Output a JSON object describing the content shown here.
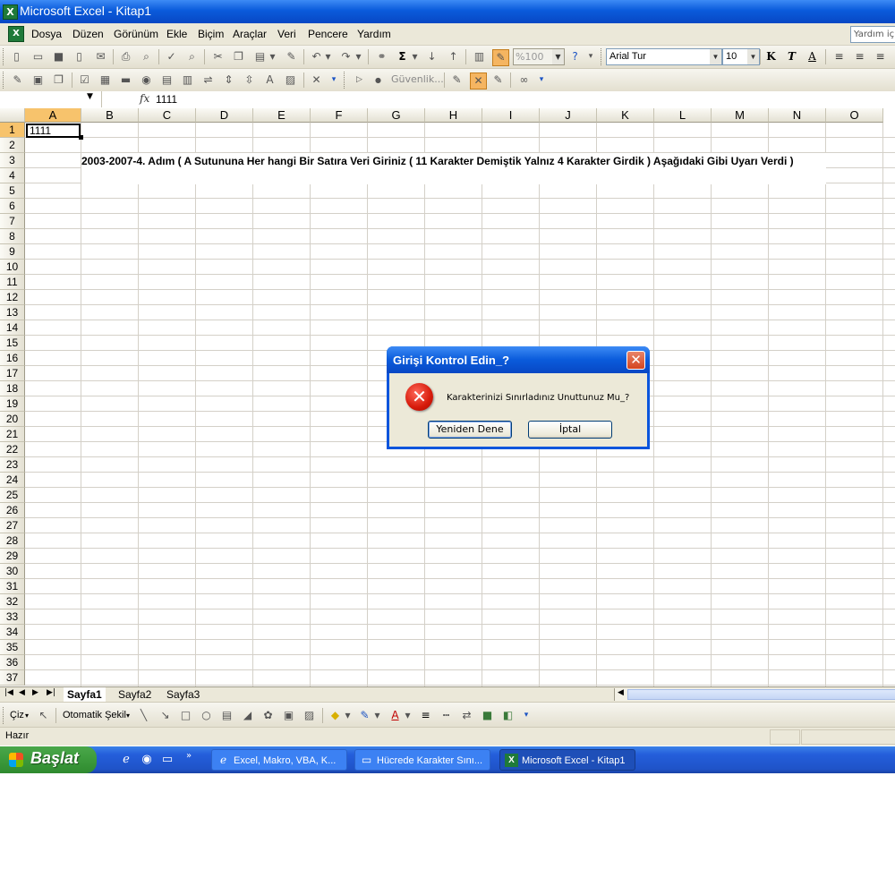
{
  "window": {
    "title": "Microsoft Excel - Kitap1"
  },
  "menu": {
    "items": [
      "Dosya",
      "Düzen",
      "Görünüm",
      "Ekle",
      "Biçim",
      "Araçlar",
      "Veri",
      "Pencere",
      "Yardım"
    ],
    "help_placeholder": "Yardım için"
  },
  "toolbar": {
    "zoom": "%100",
    "font_name": "Arial Tur",
    "font_size": "10",
    "bold": "K",
    "italic": "T",
    "underline": "A",
    "security": "Güvenlik..."
  },
  "formula_bar": {
    "name_box": "",
    "fx": "fx",
    "value": "1111"
  },
  "grid": {
    "columns": [
      "A",
      "B",
      "C",
      "D",
      "E",
      "F",
      "G",
      "H",
      "I",
      "J",
      "K",
      "L",
      "M",
      "N",
      "O"
    ],
    "rows": [
      "1",
      "2",
      "3",
      "4",
      "5",
      "6",
      "7",
      "8",
      "9",
      "10",
      "11",
      "12",
      "13",
      "14",
      "15",
      "16",
      "17",
      "18",
      "19",
      "20",
      "21",
      "22",
      "23",
      "24",
      "25",
      "26",
      "27",
      "28",
      "29",
      "30",
      "31",
      "32",
      "33",
      "34",
      "35",
      "36",
      "37"
    ],
    "cell_a1": "1111",
    "merged_text": "2003-2007-4. Adım ( A Sutununa Her hangi Bir Satıra Veri Giriniz ( 11 Karakter Demiştik Yalnız 4 Karakter Girdik ) Aşağıdaki Gibi Uyarı Verdi )"
  },
  "sheets": {
    "tabs": [
      "Sayfa1",
      "Sayfa2",
      "Sayfa3"
    ]
  },
  "draw_toolbar": {
    "draw": "Çiz",
    "autoshapes": "Otomatik Şekil"
  },
  "status": {
    "text": "Hazır"
  },
  "taskbar": {
    "start": "Başlat",
    "tasks": [
      "Excel, Makro, VBA, K...",
      "Hücrede Karakter Sını...",
      "Microsoft Excel - Kitap1"
    ]
  },
  "dialog": {
    "title": "Girişi Kontrol Edin_?",
    "message": "Karakterinizi Sınırladınız Unuttunuz Mu_?",
    "retry": "Yeniden Dene",
    "cancel": "İptal"
  },
  "colors": {
    "selection_header": "#f7c36c",
    "title_blue": "#0a5bdb",
    "start_green": "#3c9a3c"
  }
}
